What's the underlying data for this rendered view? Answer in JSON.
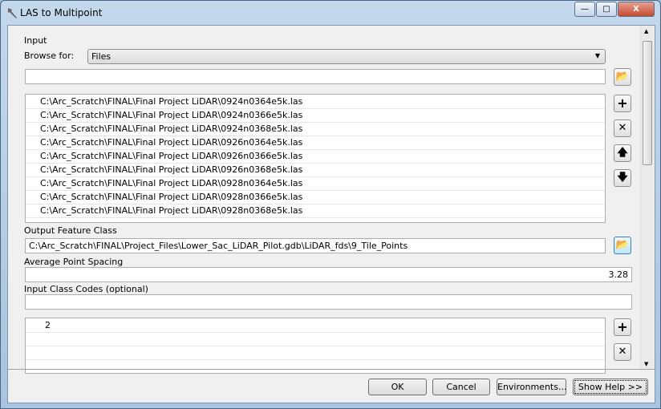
{
  "window": {
    "title": "LAS to Multipoint",
    "minimize": "—",
    "maximize": "□",
    "close": "X"
  },
  "input": {
    "label": "Input",
    "browse_label": "Browse for:",
    "browse_value": "Files",
    "path_value": "",
    "files": [
      "C:\\Arc_Scratch\\FINAL\\Final Project LiDAR\\0924n0364e5k.las",
      "C:\\Arc_Scratch\\FINAL\\Final Project LiDAR\\0924n0366e5k.las",
      "C:\\Arc_Scratch\\FINAL\\Final Project LiDAR\\0924n0368e5k.las",
      "C:\\Arc_Scratch\\FINAL\\Final Project LiDAR\\0926n0364e5k.las",
      "C:\\Arc_Scratch\\FINAL\\Final Project LiDAR\\0926n0366e5k.las",
      "C:\\Arc_Scratch\\FINAL\\Final Project LiDAR\\0926n0368e5k.las",
      "C:\\Arc_Scratch\\FINAL\\Final Project LiDAR\\0928n0364e5k.las",
      "C:\\Arc_Scratch\\FINAL\\Final Project LiDAR\\0928n0366e5k.las",
      "C:\\Arc_Scratch\\FINAL\\Final Project LiDAR\\0928n0368e5k.las"
    ]
  },
  "output": {
    "label": "Output Feature Class",
    "value": "C:\\Arc_Scratch\\FINAL\\Project_Files\\Lower_Sac_LiDAR_Pilot.gdb\\LiDAR_fds\\9_Tile_Points"
  },
  "spacing": {
    "label": "Average Point Spacing",
    "value": "3.28"
  },
  "class_codes": {
    "label": "Input Class Codes (optional)",
    "value": "",
    "codes": [
      "2"
    ]
  },
  "icons": {
    "add": "+",
    "remove": "✕",
    "up": "🡅",
    "down": "🡇"
  },
  "footer": {
    "ok": "OK",
    "cancel": "Cancel",
    "environments": "Environments...",
    "show_help": "Show Help >>"
  }
}
